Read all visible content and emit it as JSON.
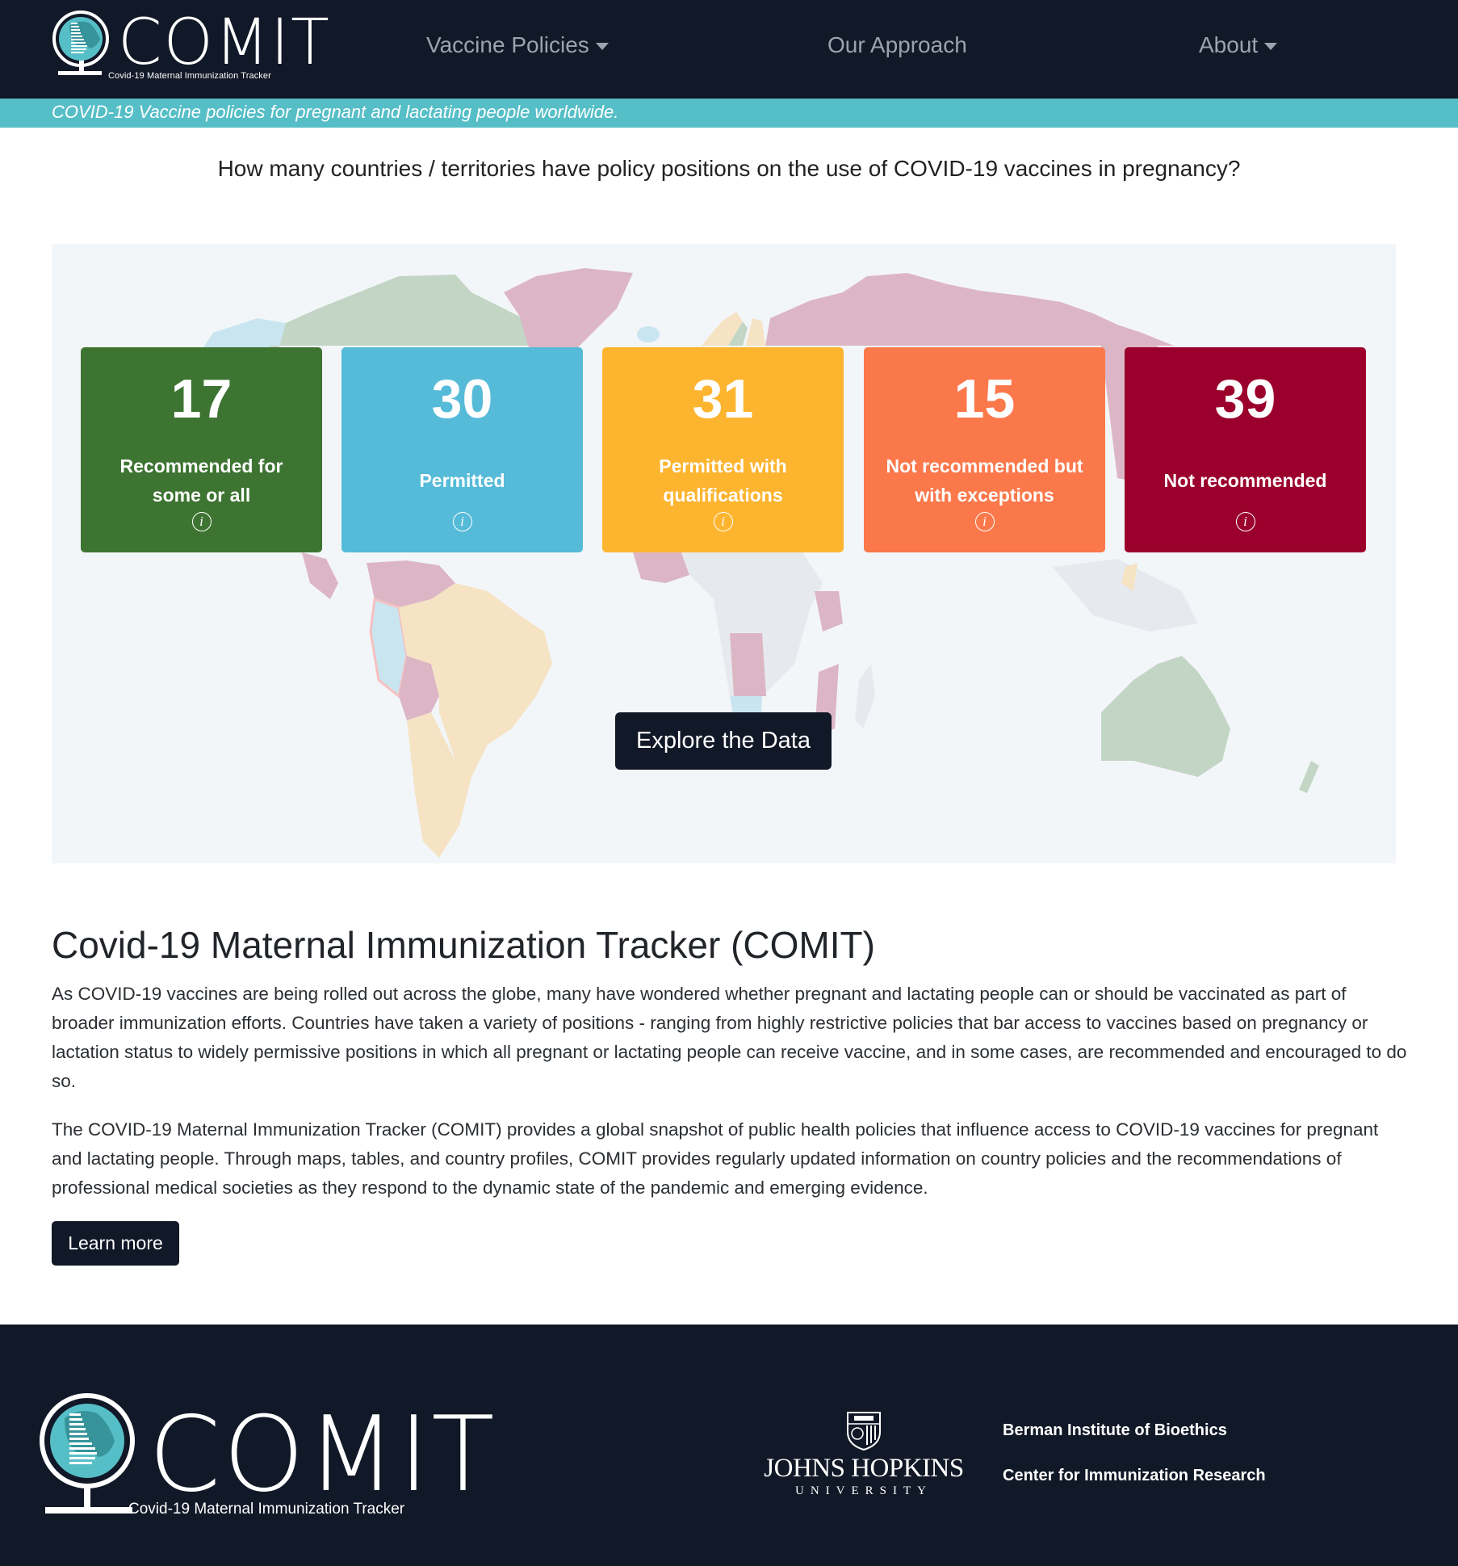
{
  "header": {
    "logo_text": "COMIT",
    "logo_subtitle": "Covid-19 Maternal Immunization Tracker",
    "nav": [
      {
        "label": "Vaccine Policies",
        "has_dropdown": true
      },
      {
        "label": "Our Approach",
        "has_dropdown": false
      },
      {
        "label": "About",
        "has_dropdown": true
      }
    ],
    "tagline": "COVID-19 Vaccine policies for pregnant and lactating people worldwide."
  },
  "hero": {
    "question": "How many countries / territories have policy positions on the use of COVID-19 vaccines in pregnancy?",
    "cards": [
      {
        "count": "17",
        "label": "Recommended for some or all",
        "color": "#3e7432",
        "map_color": "#c3d6c6",
        "info_icon": "info-icon"
      },
      {
        "count": "30",
        "label": "Permitted",
        "color": "#55bbd8",
        "map_color": "#c9e5f0",
        "info_icon": "info-icon"
      },
      {
        "count": "31",
        "label": "Permitted with qualifications",
        "color": "#fdb42f",
        "map_color": "#f5e3c4",
        "info_icon": "info-icon"
      },
      {
        "count": "15",
        "label": "Not recommended but with exceptions",
        "color": "#fb784b",
        "map_color": "#f6d3cc",
        "info_icon": "info-icon"
      },
      {
        "count": "39",
        "label": "Not recommended",
        "color": "#9b002c",
        "map_color": "#dcb6c5",
        "info_icon": "info-icon"
      }
    ],
    "explore_button": "Explore the Data"
  },
  "about": {
    "title": "Covid-19 Maternal Immunization Tracker (COMIT)",
    "paragraph1": "As COVID-19 vaccines are being rolled out across the globe, many have wondered whether pregnant and lactating people can or should be vaccinated as part of broader immunization efforts. Countries have taken a variety of positions - ranging from highly restrictive policies that bar access to vaccines based on pregnancy or lactation status to widely permissive positions in which all pregnant or lactating people can receive vaccine, and in some cases, are recommended and encouraged to do so.",
    "paragraph2": "The COVID-19 Maternal Immunization Tracker (COMIT) provides a global snapshot of public health policies that influence access to COVID-19 vaccines for pregnant and lactating people. Through maps, tables, and country profiles, COMIT provides regularly updated information on country policies and the recommendations of professional medical societies as they respond to the dynamic state of the pandemic and emerging evidence.",
    "learn_more_button": "Learn more"
  },
  "footer": {
    "logo_text": "COMIT",
    "logo_subtitle": "Covid-19 Maternal Immunization Tracker",
    "jhu_name": "JOHNS HOPKINS",
    "jhu_sub": "UNIVERSITY",
    "partners": [
      "Berman Institute of Bioethics",
      "Center for Immunization Research"
    ]
  },
  "colors": {
    "dark": "#111827",
    "teal": "#56bec7",
    "map_bg": "#f3f6f9",
    "map_nodata": "#e6e9ed"
  }
}
